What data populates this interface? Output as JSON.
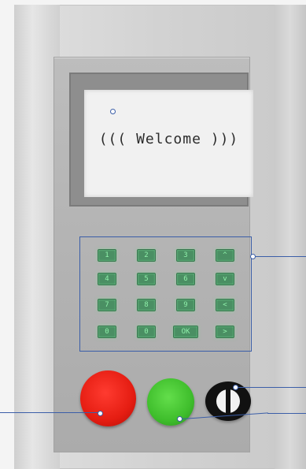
{
  "display": {
    "message": "((( Welcome )))"
  },
  "keypad": {
    "keys": [
      {
        "label": "1"
      },
      {
        "label": "2"
      },
      {
        "label": "3"
      },
      {
        "label": "^"
      },
      {
        "label": "4"
      },
      {
        "label": "5"
      },
      {
        "label": "6"
      },
      {
        "label": "v"
      },
      {
        "label": "7"
      },
      {
        "label": "8"
      },
      {
        "label": "9"
      },
      {
        "label": "<"
      },
      {
        "label": "0"
      },
      {
        "label": "0"
      },
      {
        "label": "OK"
      },
      {
        "label": ">"
      }
    ]
  },
  "colors": {
    "stop_button": "#e51d12",
    "start_button": "#3fbe2c",
    "key_backlight": "#8ff0aa",
    "callout": "#3b5ea8"
  }
}
